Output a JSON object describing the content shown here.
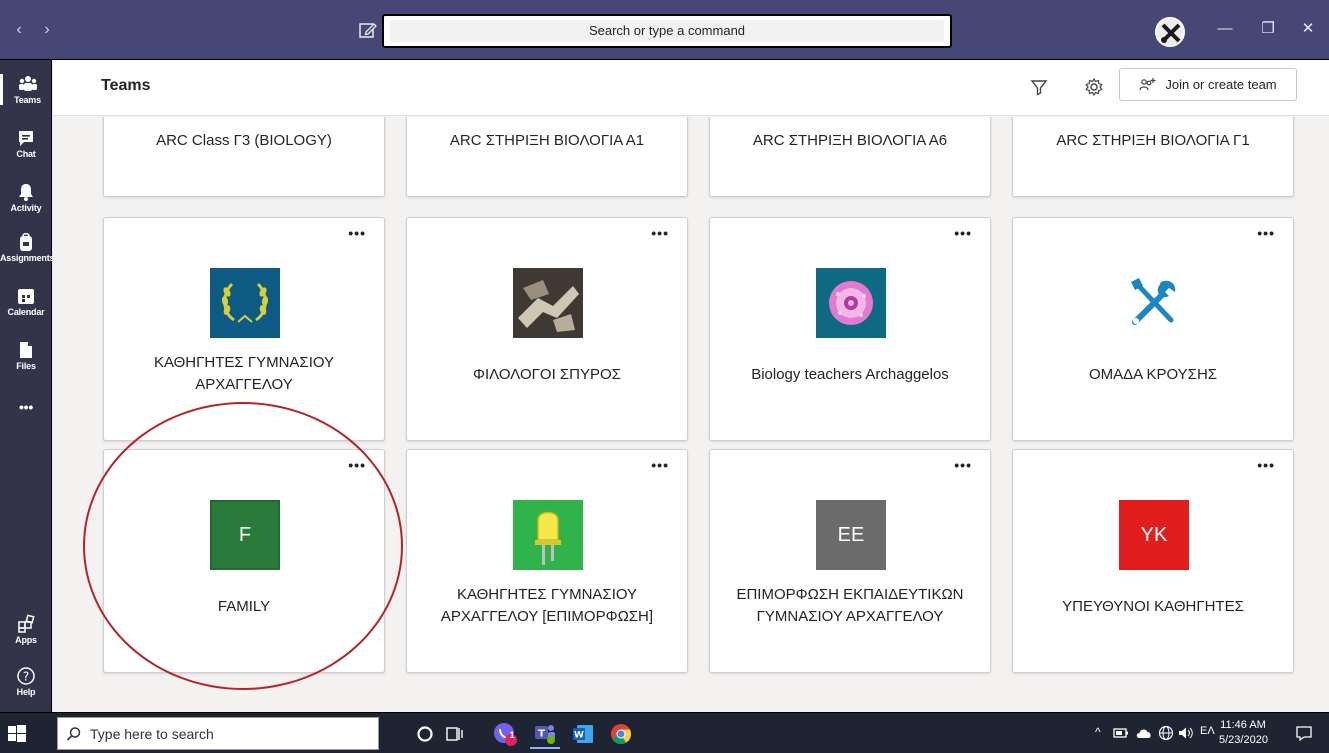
{
  "titlebar": {
    "back": "‹",
    "forward": "›",
    "search_placeholder": "Search or type a command",
    "minimize": "—",
    "maximize": "❐",
    "close": "✕"
  },
  "rail": [
    {
      "label": "Teams",
      "icon": "teams-icon",
      "active": true
    },
    {
      "label": "Chat",
      "icon": "chat-icon"
    },
    {
      "label": "Activity",
      "icon": "bell-icon"
    },
    {
      "label": "Assignments",
      "icon": "backpack-icon"
    },
    {
      "label": "Calendar",
      "icon": "calendar-icon"
    },
    {
      "label": "Files",
      "icon": "file-icon"
    },
    {
      "label": "•••",
      "icon": "more-icon"
    },
    {
      "label": "Apps",
      "icon": "apps-icon"
    },
    {
      "label": "Help",
      "icon": "help-icon"
    }
  ],
  "header": {
    "title": "Teams",
    "join_label": "Join or create team"
  },
  "teams": {
    "row1": [
      "ARC Class Γ3 (BIOLOGY)",
      "ARC ΣΤΗΡΙΞΗ ΒΙΟΛΟΓΙΑ Α1",
      "ARC ΣΤΗΡΙΞΗ ΒΙΟΛΟΓΙΑ Α6",
      "ARC ΣΤΗΡΙΞΗ ΒΙΟΛΟΓΙΑ Γ1"
    ],
    "row2": [
      {
        "line1": "ΚΑΘΗΓΗΤΕΣ ΓΥΜΝΑΣΙΟΥ",
        "line2": "ΑΡΧΑΓΓΕΛΟΥ"
      },
      {
        "line1": "ΦΙΛΟΛΟΓΟΙ ΣΠΥΡΟΣ",
        "line2": ""
      },
      {
        "line1": "Biology teachers Archaggelos",
        "line2": ""
      },
      {
        "line1": "ΟΜΑΔΑ ΚΡΟΥΣΗΣ",
        "line2": ""
      }
    ],
    "row3": [
      {
        "line1": "FAMILY",
        "line2": "",
        "tile": "F"
      },
      {
        "line1": "ΚΑΘΗΓΗΤΕΣ ΓΥΜΝΑΣΙΟΥ",
        "line2": "ΑΡΧΑΓΓΕΛΟΥ [ΕΠΙΜΟΡΦΩΣΗ]"
      },
      {
        "line1": "ΕΠΙΜΟΡΦΩΣΗ ΕΚΠΑΙΔΕΥΤΙΚΩΝ",
        "line2": "ΓΥΜΝΑΣΙΟΥ ΑΡΧΑΓΓΕΛΟΥ",
        "tile": "EE"
      },
      {
        "line1": "ΥΠΕΥΘΥΝΟΙ ΚΑΘΗΓΗΤΕΣ",
        "line2": "",
        "tile": "YK"
      }
    ],
    "more": "•••"
  },
  "colors": {
    "titlebar": "#464775",
    "rail": "#33344a",
    "tile_family": "#2a7a3b",
    "tile_ee": "#6b6b6b",
    "tile_yk": "#e01e1e",
    "highlight_circle": "#b42327"
  },
  "taskbar": {
    "search_placeholder": "Type here to search",
    "lang": "ΕΛ",
    "time": "11:46 AM",
    "date": "5/23/2020",
    "badge": "1"
  }
}
